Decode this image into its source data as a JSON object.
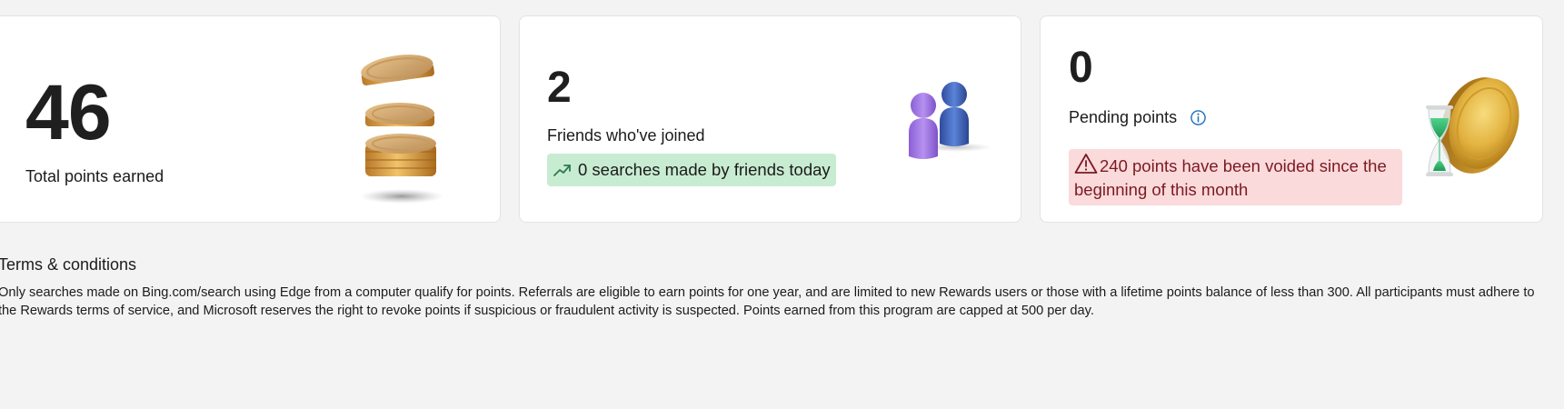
{
  "cards": {
    "total_points": {
      "value": "46",
      "label": "Total points earned",
      "art_icon": "coins-stack-illustration"
    },
    "friends": {
      "value": "2",
      "label": "Friends who've joined",
      "badge_text": "0 searches made by friends today",
      "badge_icon": "trending-up-icon",
      "badge_color": "#c8ecd2",
      "art_icon": "two-people-illustration"
    },
    "pending": {
      "value": "0",
      "label": "Pending points",
      "info_icon": "info-icon",
      "warning_text": "240 points have been voided since the beginning of this month",
      "warning_icon": "warning-triangle-icon",
      "warning_color": "#fbdadb",
      "art_icon": "coin-hourglass-illustration"
    }
  },
  "terms": {
    "title": "Terms & conditions",
    "body": "Only searches made on Bing.com/search using Edge from a computer qualify for points. Referrals are eligible to earn points for one year, and are limited to new Rewards users or those with a lifetime points balance of less than 300. All participants must adhere to the Rewards terms of service, and Microsoft reserves the right to revoke points if suspicious or fraudulent activity is suspected. Points earned from this program are capped at 500 per day."
  }
}
